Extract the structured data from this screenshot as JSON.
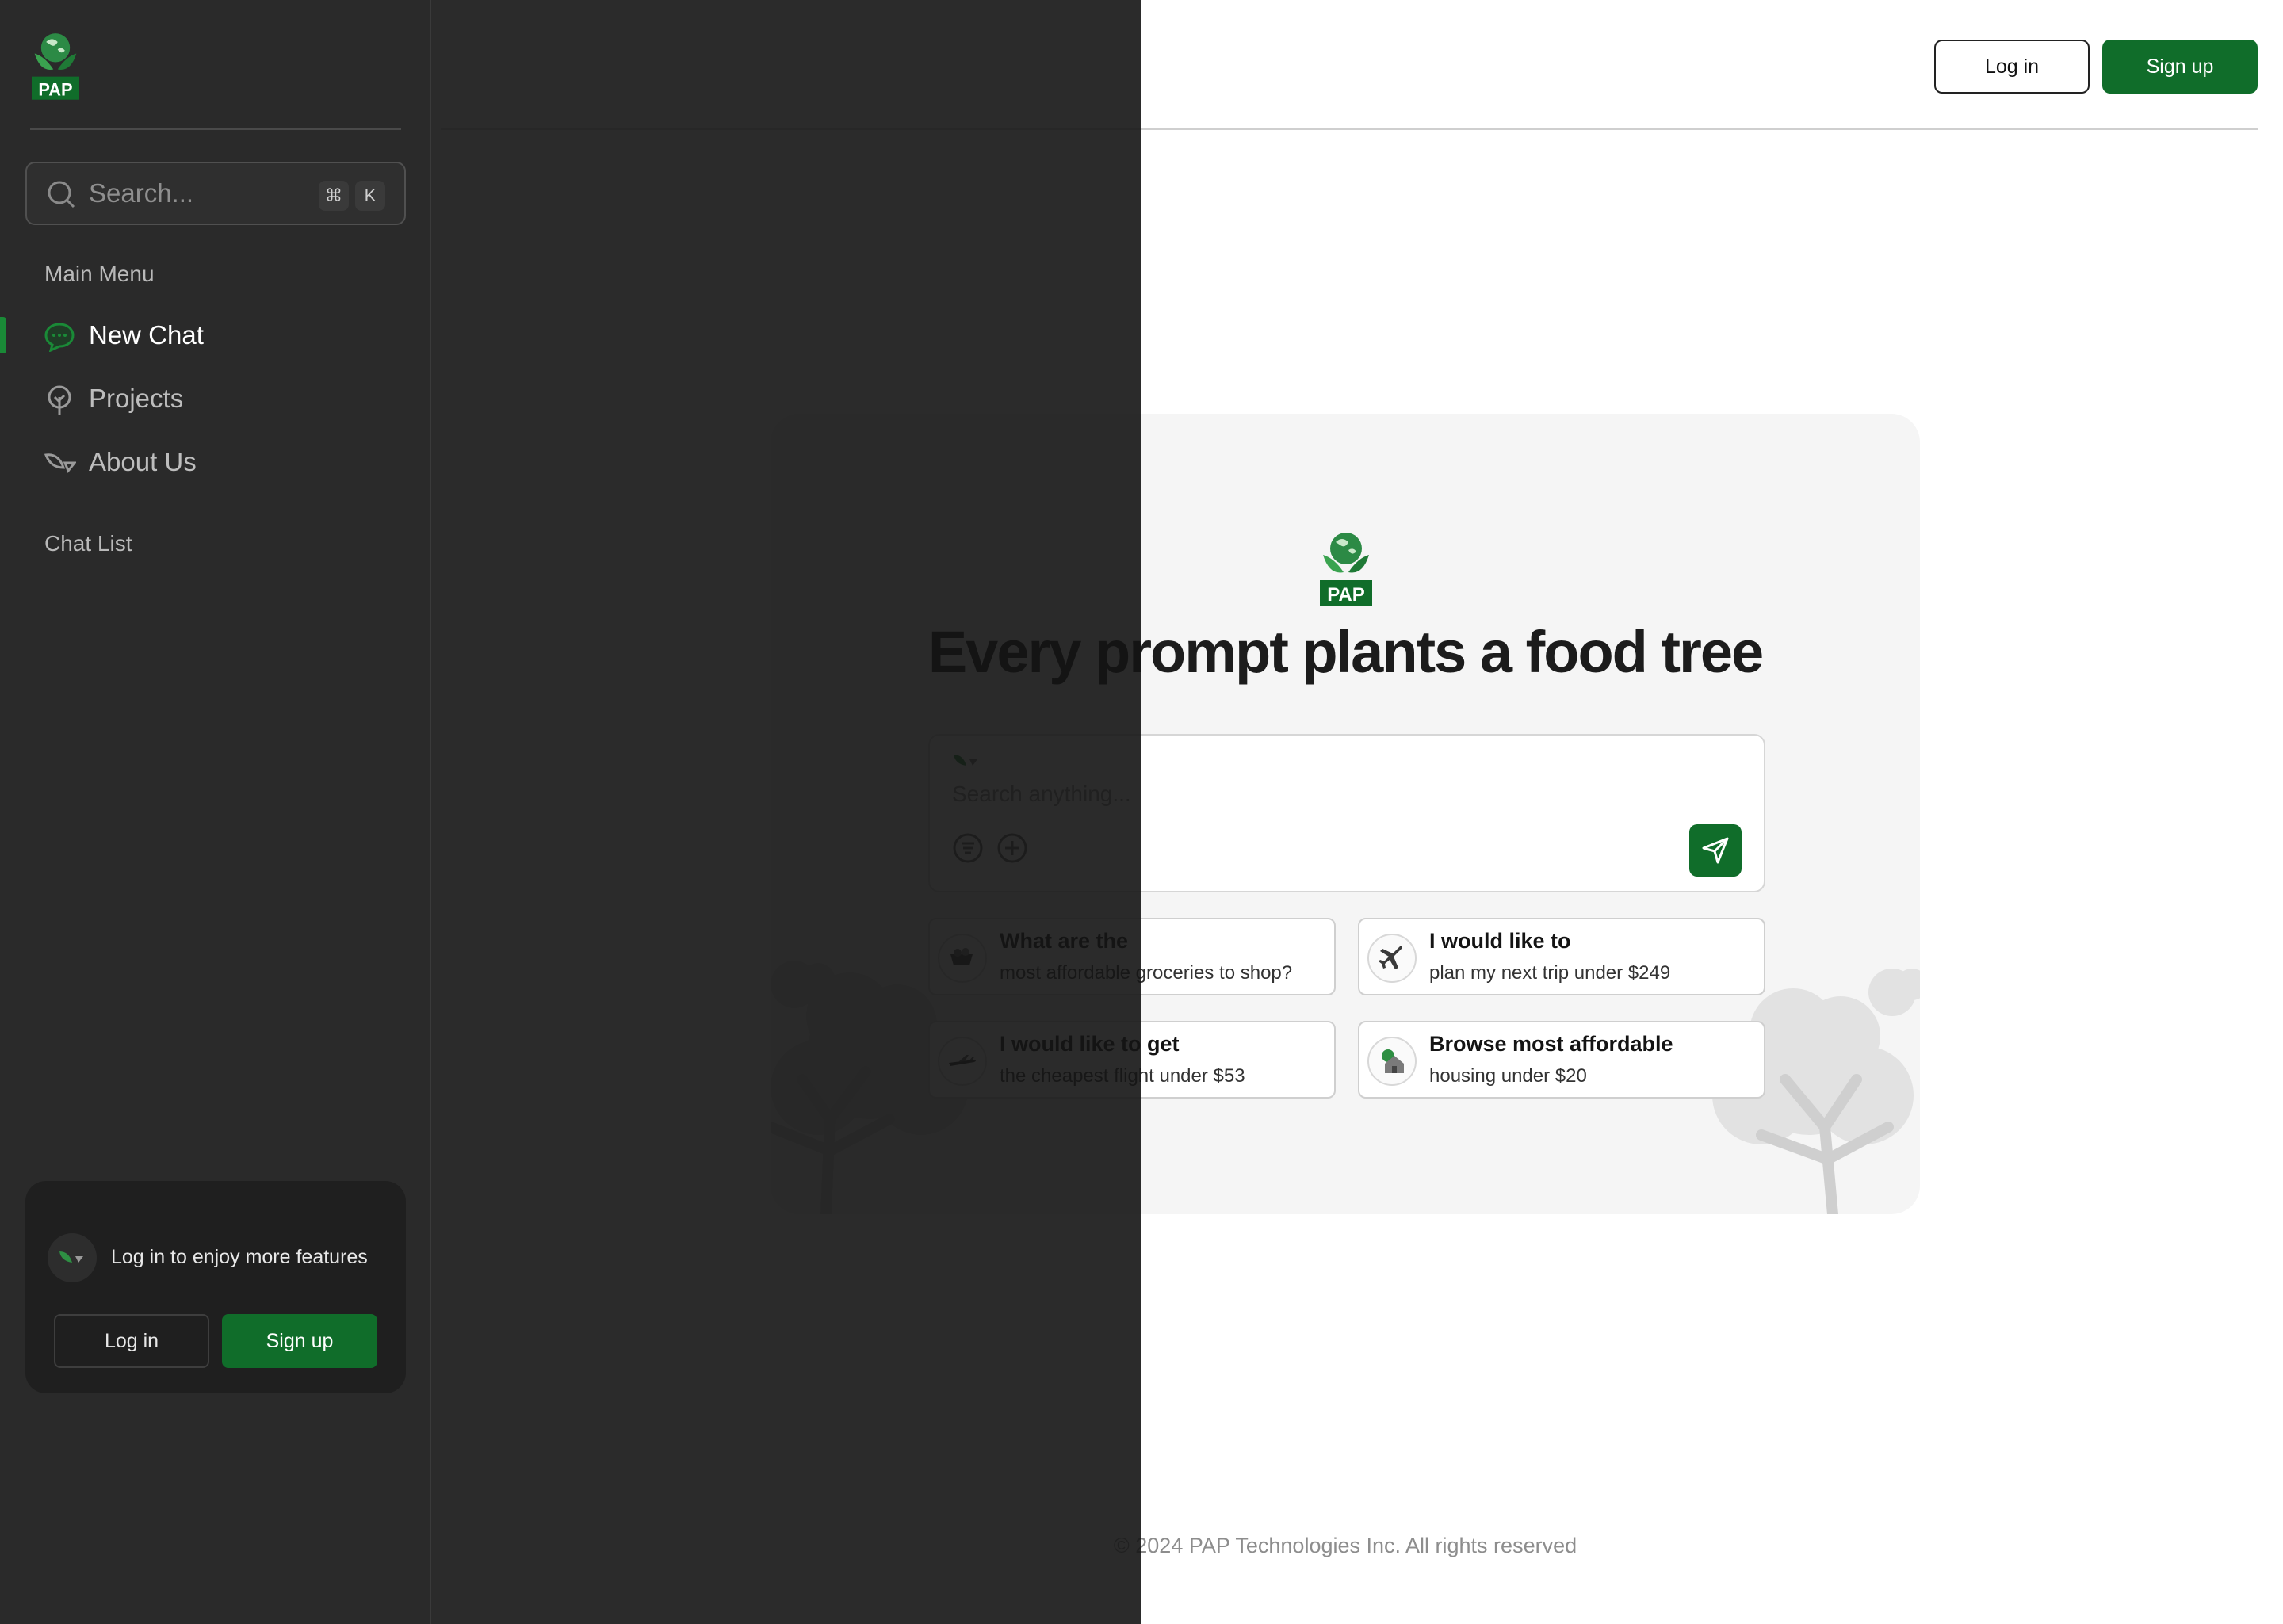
{
  "brand": {
    "logo_text": "PAP"
  },
  "header": {
    "login_label": "Log in",
    "signup_label": "Sign up"
  },
  "sidebar": {
    "search": {
      "placeholder": "Search...",
      "shortcut_keys": [
        "⌘",
        "K"
      ]
    },
    "main_menu_heading": "Main Menu",
    "items": [
      {
        "label": "New Chat",
        "icon": "chat-bubble-icon",
        "active": true
      },
      {
        "label": "Projects",
        "icon": "tree-icon",
        "active": false
      },
      {
        "label": "About Us",
        "icon": "leaf-icon",
        "active": false
      }
    ],
    "chat_list_heading": "Chat List",
    "login_card": {
      "message": "Log in to enjoy more features",
      "login_label": "Log in",
      "signup_label": "Sign up"
    }
  },
  "hero": {
    "title": "Every prompt plants a food tree",
    "prompt_placeholder": "Search anything...",
    "suggestions": [
      {
        "title": "What are the",
        "subtitle": "most affordable groceries to shop?",
        "icon": "groceries-icon"
      },
      {
        "title": "I would like to",
        "subtitle": "plan my next trip under $249",
        "icon": "airplane-icon"
      },
      {
        "title": "I would like to get",
        "subtitle": "the cheapest flight under $53",
        "icon": "flight-icon"
      },
      {
        "title": "Browse most affordable",
        "subtitle": "housing under $20",
        "icon": "house-icon"
      }
    ]
  },
  "footer": {
    "copyright": "© 2024 PAP Technologies Inc. All rights reserved"
  },
  "colors": {
    "brand_green": "#106d2a",
    "sidebar_bg": "#2a2a2a",
    "card_bg": "#f5f5f5"
  }
}
